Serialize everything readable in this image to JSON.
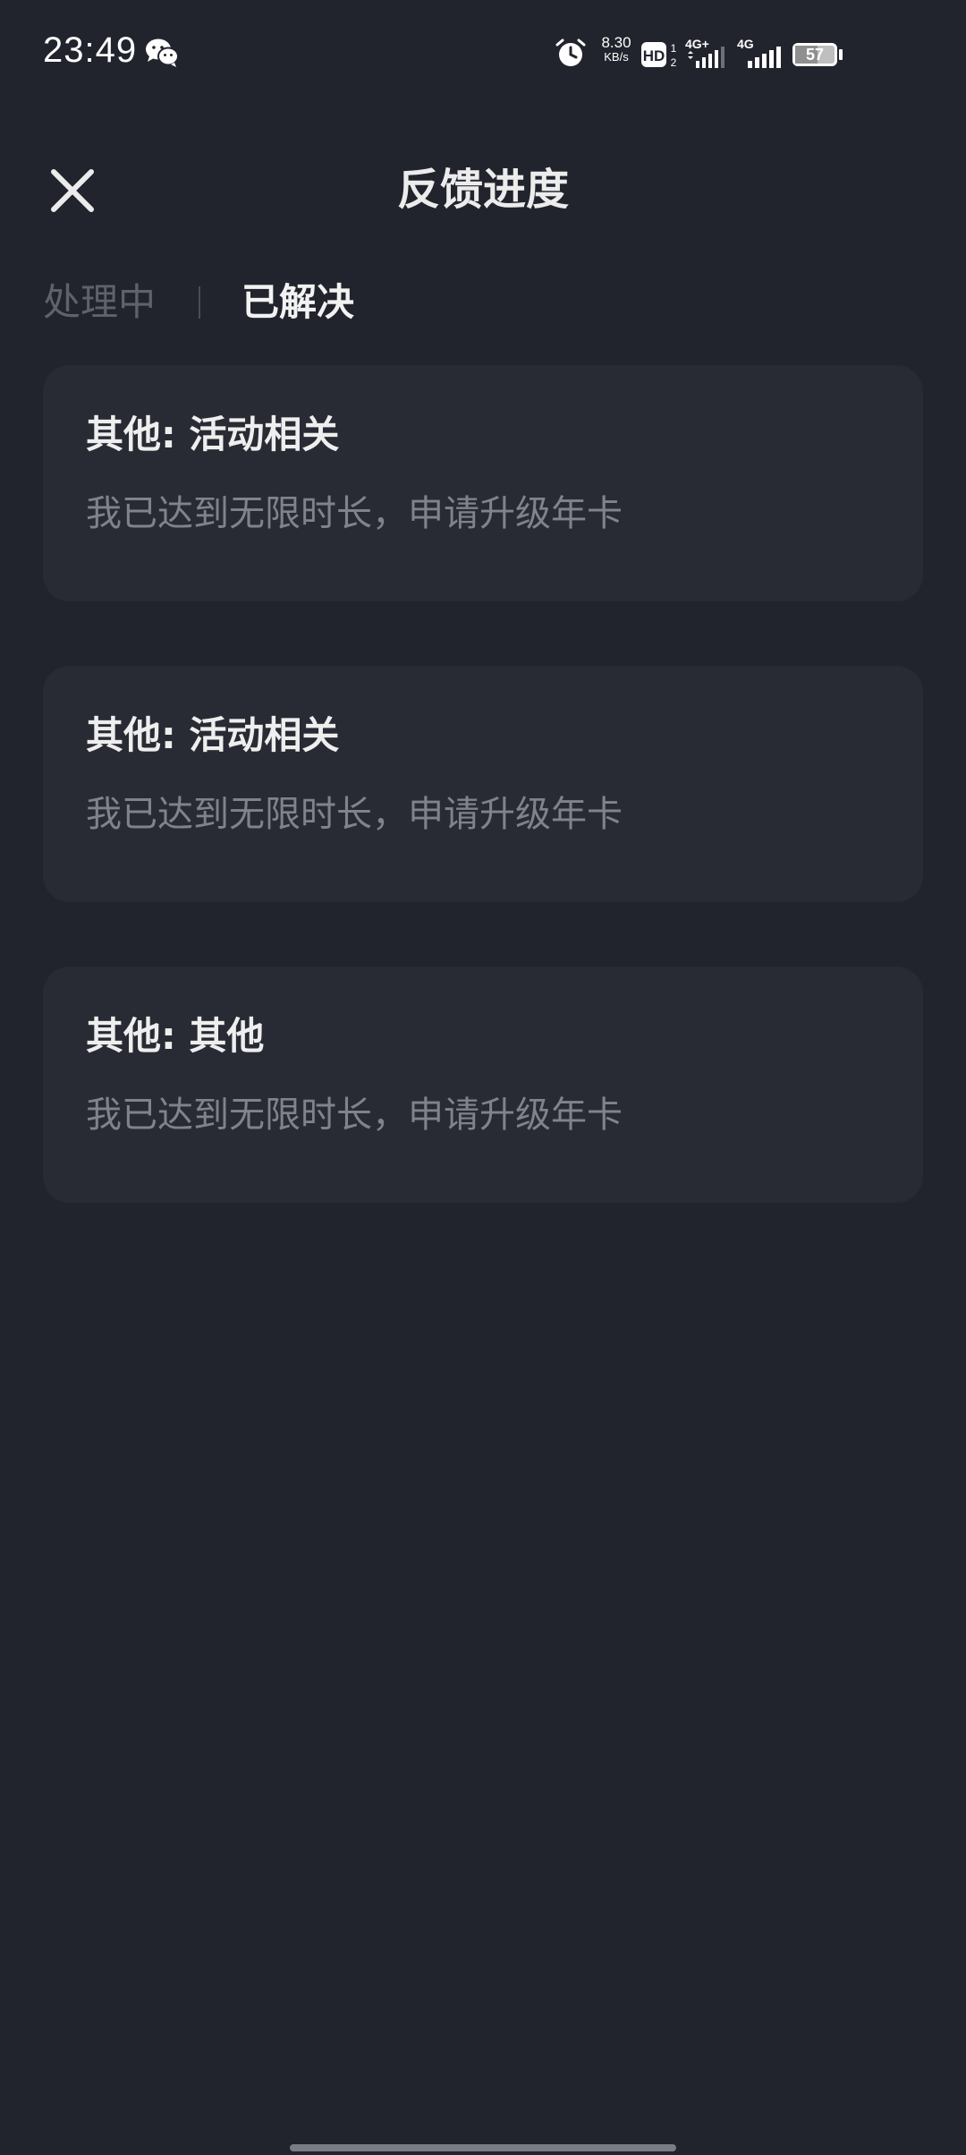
{
  "status_bar": {
    "time": "23:49",
    "net_speed_value": "8.30",
    "net_speed_unit": "KB/s",
    "signal_1_label": "4G+",
    "signal_2_label": "4G",
    "battery": "57",
    "battery_level": 0.57
  },
  "header": {
    "title": "反馈进度"
  },
  "tabs": [
    {
      "label": "处理中",
      "active": false
    },
    {
      "label": "已解决",
      "active": true
    }
  ],
  "cards": [
    {
      "title": "其他: 活动相关",
      "description": "我已达到无限时长，申请升级年卡"
    },
    {
      "title": "其他: 活动相关",
      "description": "我已达到无限时长，申请升级年卡"
    },
    {
      "title": "其他: 其他",
      "description": "我已达到无限时长，申请升级年卡"
    }
  ],
  "colors": {
    "background": "#22242d",
    "card": "#292b34",
    "text_primary": "#eeeeee",
    "text_secondary": "#80838c",
    "tab_inactive": "#5f626c"
  }
}
